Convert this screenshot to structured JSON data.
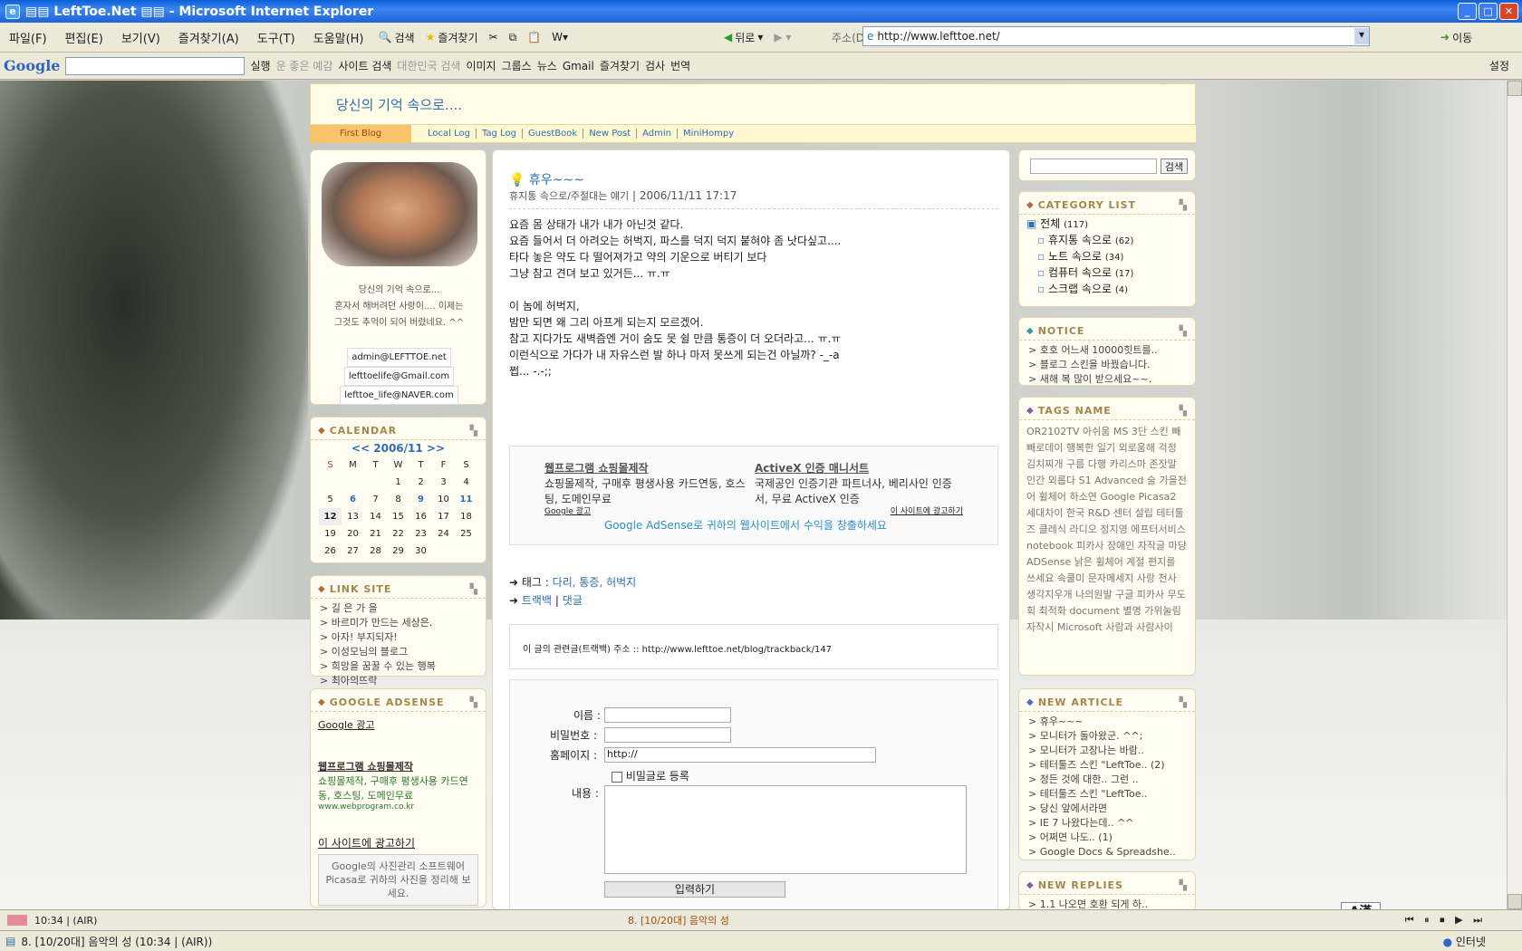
{
  "window": {
    "title": "▤▤ LeftToe.Net ▤▤ - Microsoft Internet Explorer"
  },
  "menu": [
    "파일(F)",
    "편집(E)",
    "보기(V)",
    "즐겨찾기(A)",
    "도구(T)",
    "도움말(H)"
  ],
  "toolbar": {
    "search": "검색",
    "favorites": "즐겨찾기",
    "back": "뒤로",
    "address_label": "주소(D)",
    "address": "http://www.lefttoe.net/",
    "go": "이동"
  },
  "googlebar": {
    "logo": "Google",
    "run": "실행",
    "good": "운 좋은 예감",
    "site_search": "사이트 검색",
    "korea": "대한민국 검색",
    "image": "이미지",
    "groups": "그룹스",
    "news": "뉴스",
    "gmail": "Gmail",
    "fav": "즐겨찾기",
    "check": "검사",
    "translate": "번역",
    "settings": "설정"
  },
  "blog": {
    "header_title": "당신의 기억 속으로....",
    "nav": [
      "First Blog",
      "Local Log",
      "Tag Log",
      "GuestBook",
      "New Post",
      "Admin",
      "MiniHompy"
    ],
    "profile": {
      "line1": "당신의 기억 속으로...",
      "line2": "혼자서 해버려던 사랑이.... 이제는",
      "line3": "그것도 추억이 되어 버렸네요. ^^",
      "email1": "admin@LEFTTOE.net",
      "email2": "lefttoelife@Gmail.com",
      "email3": "lefttoe_life@NAVER.com"
    },
    "calendar": {
      "title": "CALENDAR",
      "month": "<<  2006/11  >>",
      "days": [
        "S",
        "M",
        "T",
        "W",
        "T",
        "F",
        "S"
      ],
      "rows": [
        [
          "",
          "",
          "",
          "1",
          "2",
          "3",
          "4"
        ],
        [
          "5",
          "6",
          "7",
          "8",
          "9",
          "10",
          "11"
        ],
        [
          "12",
          "13",
          "14",
          "15",
          "16",
          "17",
          "18"
        ],
        [
          "19",
          "20",
          "21",
          "22",
          "23",
          "24",
          "25"
        ],
        [
          "26",
          "27",
          "28",
          "29",
          "30",
          "",
          ""
        ]
      ]
    },
    "links": {
      "title": "LINK SITE",
      "items": [
        "> 길 은 가 을",
        "> 바르미가 만드는 세상은.",
        "> 아자! 부지되자!",
        "> 이성모님의 블로그",
        "> 희망을 꿈꿀 수 있는 행복",
        "> 최아의뜨락"
      ]
    },
    "adsense_left": {
      "title": "GOOGLE ADSENSE",
      "label": "Google 광고",
      "ad_title": "웹프로그램 쇼핑몰제작",
      "ad_text": "쇼핑몰제작, 구매후 평생사용 카드연동, 호스팅, 도메인무료",
      "ad_url": "www.webprogram.co.kr",
      "advertise": "이 사이트에 광고하기",
      "picasa": "Google의 사진관리 소프트웨어 Picasa로 귀하의 사진을 정리해 보세요."
    },
    "post": {
      "title": "휴우~~~",
      "category": "휴지통 속으로/주절대는 얘기",
      "date": "2006/11/11 17:17",
      "lines": [
        "요즘 몸 상태가 내가 내가 아닌것 같다.",
        "요즘 들어서 더 아려오는 허벅지, 파스를 덕지 덕지 붙혀야 좀 낫다싶고....",
        "타다 놓은 약도 다 떨어져가고 약의 기운으로 버티기 보다",
        "그냥 참고 견뎌 보고 있거든... ㅠ.ㅠ",
        "",
        "이 놈에 허벅지,",
        "밤만 되면 왜 그리 아프게 되는지 모르겠어.",
        "참고 지다가도 새벽즘엔 거이 숨도 못 쉴 만큼 통증이 더 오더라고... ㅠ.ㅠ",
        "이런식으로 가다가 내 자유스런 발 하나 마저 못쓰게 되는건 아닐까? -_-a",
        "쩝... -.-;;"
      ],
      "ad1_title": "웹프로그램 쇼핑몰제작",
      "ad1_text": "쇼핑몰제작, 구매후 평생사용 카드연동, 호스팅, 도메인무료",
      "ad2_title": "ActiveX 인증 매니서트",
      "ad2_text": "국제공인 인증기관 파트너사, 베리사인 인증서, 무료 ActiveX 인증",
      "ad_label": "Google 광고",
      "ad_site": "이 사이트에 광고하기",
      "ad_bottom": "Google AdSense로 귀하의 웹사이트에서 수익을 창출하세요",
      "tags_label": "태그 :",
      "tags": "다리, 통증, 허벅지",
      "trackback": "트랙백",
      "comment": "댓글",
      "trackback_url": "이 글의 관련글(트랙백) 주소 :: http://www.lefttoe.net/blog/trackback/147",
      "form": {
        "name": "이름 :",
        "password": "비밀번호 :",
        "homepage": "홈페이지 :",
        "homepage_value": "http://",
        "secret": "비밀글로 등록",
        "content": "내용 :",
        "submit": "입력하기"
      }
    },
    "search_btn": "검색",
    "category": {
      "title": "CATEGORY LIST",
      "all": "전체",
      "all_count": "(117)",
      "items": [
        {
          "name": "휴지통 속으로",
          "count": "(62)"
        },
        {
          "name": "노트 속으로",
          "count": "(34)"
        },
        {
          "name": "컴퓨터 속으로",
          "count": "(17)"
        },
        {
          "name": "스크랩 속으로",
          "count": "(4)"
        }
      ]
    },
    "notice": {
      "title": "NOTICE",
      "items": [
        "> 호호 어느새 10000힛트를..",
        "> 블로그 스킨을 바꿨습니다.",
        "> 새해 복 많이 받으세요~~."
      ]
    },
    "tags": {
      "title": "TAGS NAME",
      "cloud": "OR2102TV 아쉬움 MS 3단 스킨 빼빼로데이 행복한 일기 외로움해 걱정 김치찌개 구름 다행 카리스마 존잣말 인간 외롭다 S1 Advanced 술 가을전어 휠체어 하소연 Google Picasa2 세대차이 한국 R&D 센터 설립 테터툴즈 클레식 라디오 정지영 에프터서비스 notebook 피카사 장애인 자작글 마당 ADSense 낡은 휠체어 계절 편지를 쓰세요 속쿨미 문자메세지 사랑 천사 생각지우개 나의원발 구글 피카사 무도회 최적화 document 별명 가위눌림 자작시 Microsoft 사람과 사람사이"
    },
    "new_article": {
      "title": "NEW ARTICLE",
      "items": [
        "> 휴우~~~",
        "> 모니터가 돌아왔군. ^^;",
        "> 모니터가 고장나는 바람..",
        "> 테터툴즈 스킨 \"LeftToe.. (2)",
        "> 정든 것에 대한.. 그런 ..",
        "> 테터툴즈 스킨 \"LeftToe..",
        "> 당신 앞에서라면",
        "> IE 7 나왔다는데.. ^^",
        "> 어쩌면 나도.. (1)",
        "> Google Docs & Spreadshe.."
      ]
    },
    "new_replies": {
      "title": "NEW REPLIES",
      "items": [
        "> 1.1 나오면 호환 되게 하.."
      ]
    }
  },
  "media": {
    "time": "10:34 | (AIR)",
    "track": "8. [10/20대] 음악의 성"
  },
  "status": {
    "text": "8. [10/20대] 음악의 성 (10:34 | (AIR))",
    "zone": "인터넷"
  },
  "ime": "A漢"
}
